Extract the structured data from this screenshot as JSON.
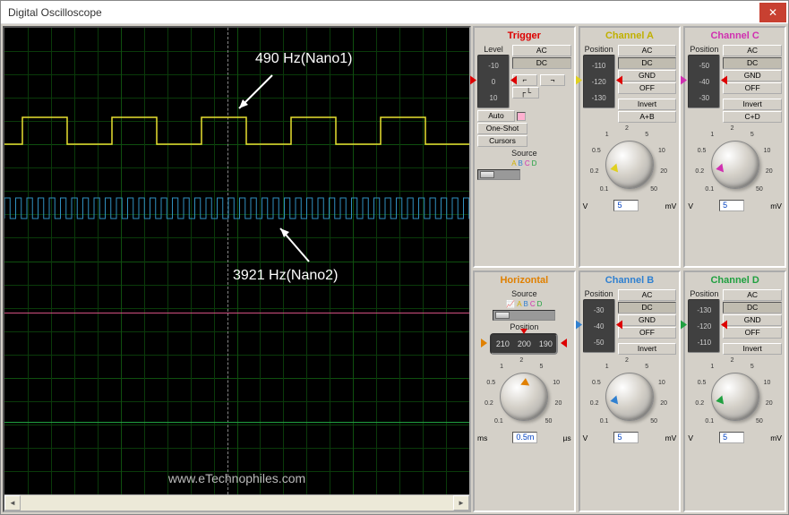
{
  "window": {
    "title": "Digital Oscilloscope"
  },
  "annotations": {
    "nano1": "490 Hz(Nano1)",
    "nano2": "3921 Hz(Nano2)"
  },
  "watermark": "www.eTechnophiles.com",
  "trigger": {
    "title": "Trigger",
    "level_label": "Level",
    "wheel": [
      "-10",
      "0",
      "10"
    ],
    "ac": "AC",
    "dc": "DC",
    "auto": "Auto",
    "oneshot": "One-Shot",
    "cursors": "Cursors",
    "source_label": "Source"
  },
  "horizontal": {
    "title": "Horizontal",
    "source_label": "Source",
    "position_label": "Position",
    "pos_values": [
      "210",
      "200",
      "190"
    ],
    "unit_left": "ms",
    "unit_val": "0.5m",
    "unit_right": "µs"
  },
  "channels": {
    "A": {
      "title": "Channel A",
      "wheel": [
        "-110",
        "-120",
        "-130"
      ],
      "extra": "A+B"
    },
    "B": {
      "title": "Channel B",
      "wheel": [
        "-30",
        "-40",
        "-50"
      ],
      "extra": ""
    },
    "C": {
      "title": "Channel C",
      "wheel": [
        "-50",
        "-40",
        "-30"
      ],
      "extra": "C+D"
    },
    "D": {
      "title": "Channel D",
      "wheel": [
        "-130",
        "-120",
        "-110"
      ],
      "extra": ""
    }
  },
  "ch_common": {
    "position": "Position",
    "ac": "AC",
    "dc": "DC",
    "gnd": "GND",
    "off": "OFF",
    "invert": "Invert",
    "unit_left": "V",
    "unit_val": "5",
    "unit_right": "mV"
  },
  "sources": {
    "A": "A",
    "B": "B",
    "C": "C",
    "D": "D"
  },
  "knob_scale": [
    "0.1",
    "0.2",
    "0.5",
    "1",
    "2",
    "5",
    "10",
    "20",
    "50"
  ]
}
